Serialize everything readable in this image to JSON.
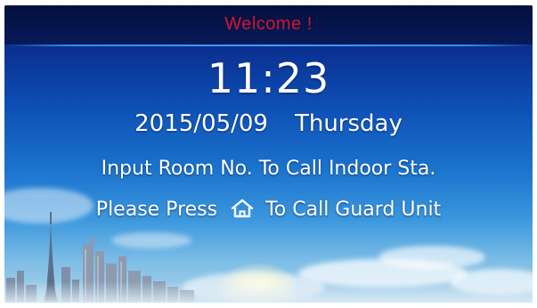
{
  "header": {
    "welcome_text": "Welcome !"
  },
  "clock": {
    "time": "11:23",
    "date": "2015/05/09",
    "weekday": "Thursday"
  },
  "instructions": {
    "line1": "Input Room No. To Call Indoor Sta.",
    "line2_prefix": "Please Press",
    "line2_icon": "home-icon",
    "line2_suffix": "To Call Guard Unit"
  },
  "colors": {
    "welcome_text": "#d3172a",
    "primary_text": "#ffffff",
    "header_bar": "#07195a",
    "sky_top": "#0a2f8f",
    "sky_bottom": "#aed4ea"
  }
}
